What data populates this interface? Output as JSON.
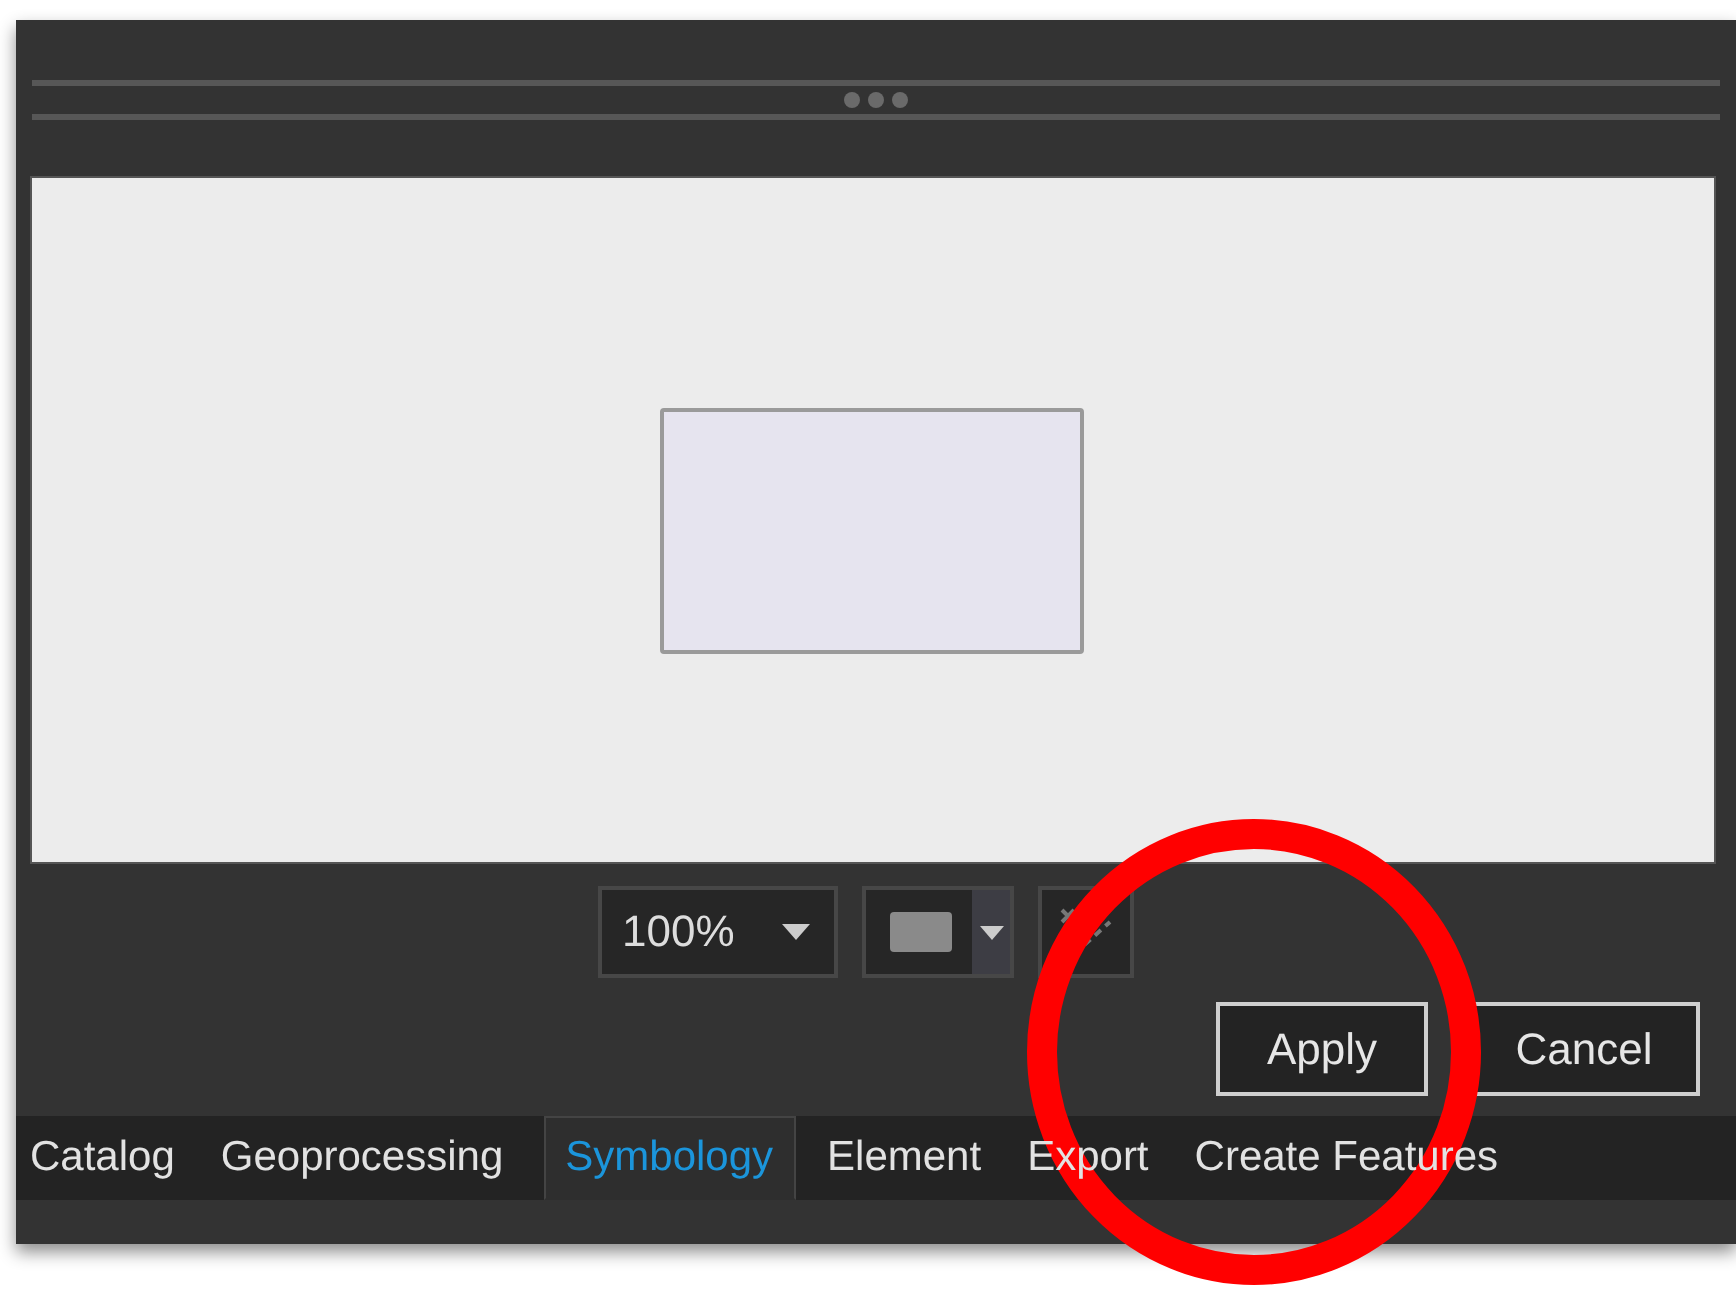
{
  "preview": {
    "kind": "rectangle"
  },
  "controls": {
    "zoom": "100%"
  },
  "buttons": [
    "Apply",
    "Cancel"
  ],
  "tabs": [
    {
      "label": "Catalog",
      "selected": false
    },
    {
      "label": "Geoprocessing",
      "selected": false
    },
    {
      "label": "Symbology",
      "selected": true
    },
    {
      "label": "Element",
      "selected": false
    },
    {
      "label": "Export",
      "selected": false
    },
    {
      "label": "Create Features",
      "selected": false
    }
  ],
  "annotation": {
    "kind": "ring"
  }
}
